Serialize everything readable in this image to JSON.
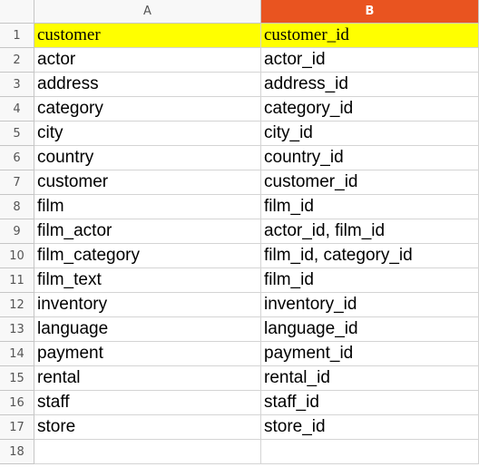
{
  "colors": {
    "header_fill": "#ffff00",
    "active_col_header": "#e95420"
  },
  "columns": [
    "A",
    "B"
  ],
  "rows": [
    {
      "num": "1",
      "a": "customer",
      "b": "customer_id"
    },
    {
      "num": "2",
      "a": "actor",
      "b": "actor_id"
    },
    {
      "num": "3",
      "a": "address",
      "b": "address_id"
    },
    {
      "num": "4",
      "a": "category",
      "b": "category_id"
    },
    {
      "num": "5",
      "a": "city",
      "b": "city_id"
    },
    {
      "num": "6",
      "a": "country",
      "b": "country_id"
    },
    {
      "num": "7",
      "a": "customer",
      "b": "customer_id"
    },
    {
      "num": "8",
      "a": "film",
      "b": "film_id"
    },
    {
      "num": "9",
      "a": "film_actor",
      "b": "actor_id, film_id"
    },
    {
      "num": "10",
      "a": "film_category",
      "b": "film_id, category_id"
    },
    {
      "num": "11",
      "a": "film_text",
      "b": "film_id"
    },
    {
      "num": "12",
      "a": "inventory",
      "b": "inventory_id"
    },
    {
      "num": "13",
      "a": "language",
      "b": "language_id"
    },
    {
      "num": "14",
      "a": "payment",
      "b": "payment_id"
    },
    {
      "num": "15",
      "a": "rental",
      "b": "rental_id"
    },
    {
      "num": "16",
      "a": "staff",
      "b": "staff_id"
    },
    {
      "num": "17",
      "a": "store",
      "b": "store_id"
    },
    {
      "num": "18",
      "a": "",
      "b": ""
    }
  ]
}
